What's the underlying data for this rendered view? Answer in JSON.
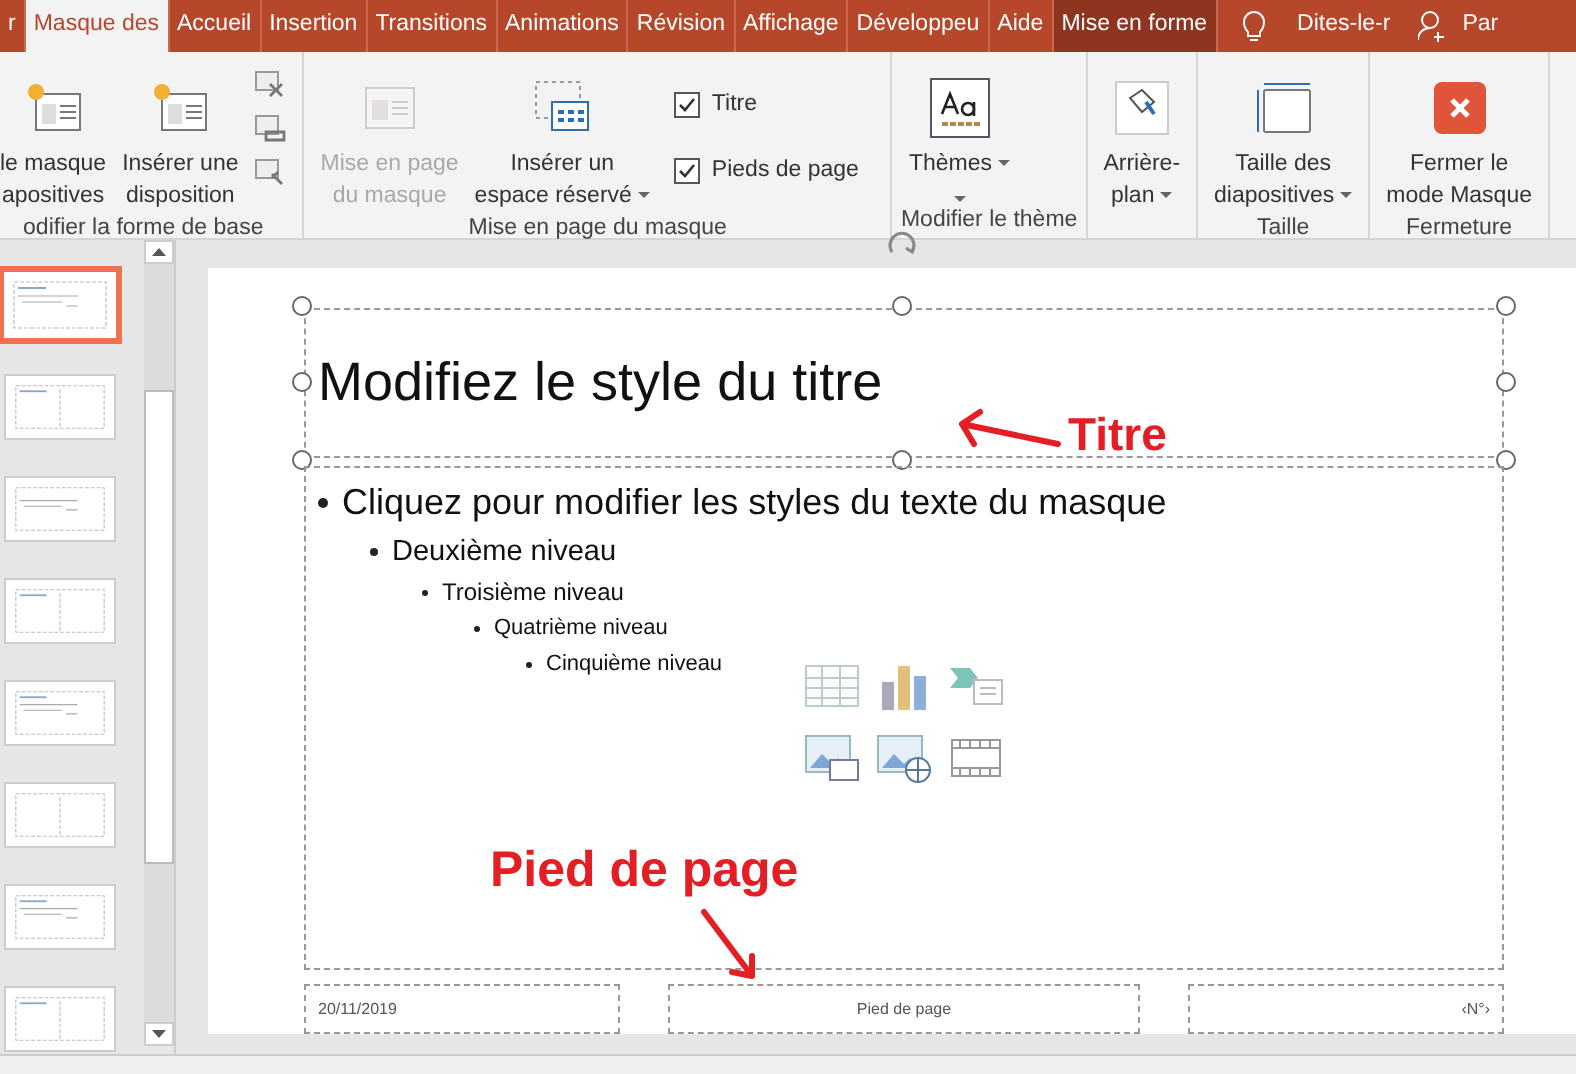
{
  "tabs": [
    {
      "label": "r",
      "selected": false,
      "kind": "tab"
    },
    {
      "label": "Masque des",
      "selected": true,
      "kind": "tab"
    },
    {
      "label": "Accueil",
      "selected": false,
      "kind": "tab"
    },
    {
      "label": "Insertion",
      "selected": false,
      "kind": "tab"
    },
    {
      "label": "Transitions",
      "selected": false,
      "kind": "tab"
    },
    {
      "label": "Animations",
      "selected": false,
      "kind": "tab"
    },
    {
      "label": "Révision",
      "selected": false,
      "kind": "tab"
    },
    {
      "label": "Affichage",
      "selected": false,
      "kind": "tab"
    },
    {
      "label": "Développeu",
      "selected": false,
      "kind": "tab"
    },
    {
      "label": "Aide",
      "selected": false,
      "kind": "tab"
    },
    {
      "label": "Mise en forme",
      "selected": false,
      "kind": "contextual"
    }
  ],
  "tell_me": "Dites-le-r",
  "account": "Par",
  "ribbon": {
    "groups": [
      {
        "label": "odifier la forme de base",
        "items": [
          {
            "kind": "large",
            "lines": [
              "le masque",
              "apositives"
            ],
            "disabled": false,
            "dropdown": false
          },
          {
            "kind": "large",
            "lines": [
              "Insérer une",
              "disposition"
            ],
            "disabled": false,
            "dropdown": false
          },
          {
            "kind": "smallicons"
          }
        ]
      },
      {
        "label": "Mise en page du masque",
        "items": [
          {
            "kind": "large",
            "lines": [
              "Mise en page",
              "du masque"
            ],
            "disabled": true,
            "dropdown": false
          },
          {
            "kind": "large",
            "lines": [
              "Insérer un",
              "espace réservé"
            ],
            "disabled": false,
            "dropdown": true
          },
          {
            "kind": "checkboxes",
            "options": [
              {
                "label": "Titre",
                "checked": true
              },
              {
                "label": "Pieds de page",
                "checked": true
              }
            ]
          }
        ]
      },
      {
        "label": "Modifier le thème",
        "items": [
          {
            "kind": "large",
            "lines": [
              "Thèmes"
            ],
            "disabled": false,
            "dropdown": true
          }
        ]
      },
      {
        "items": [
          {
            "kind": "large",
            "lines": [
              "Arrière-",
              "plan"
            ],
            "disabled": false,
            "dropdown": true
          }
        ]
      },
      {
        "label": "Taille",
        "items": [
          {
            "kind": "large",
            "lines": [
              "Taille des",
              "diapositives"
            ],
            "disabled": false,
            "dropdown": true
          }
        ]
      },
      {
        "label": "Fermeture",
        "items": [
          {
            "kind": "large",
            "lines": [
              "Fermer le",
              "mode Masque"
            ],
            "disabled": false,
            "dropdown": false
          }
        ]
      }
    ]
  },
  "thumbnails": [
    {
      "selected": true
    },
    {
      "selected": false
    },
    {
      "selected": false
    },
    {
      "selected": false
    },
    {
      "selected": false
    },
    {
      "selected": false
    },
    {
      "selected": false
    },
    {
      "selected": false
    }
  ],
  "slide": {
    "title": "Modifiez le style du titre",
    "body": [
      {
        "text": "Cliquez pour modifier les styles du texte du masque",
        "children": [
          {
            "text": "Deuxième niveau",
            "children": [
              {
                "text": "Troisième niveau",
                "children": [
                  {
                    "text": "Quatrième niveau",
                    "children": [
                      {
                        "text": "Cinquième niveau"
                      }
                    ]
                  }
                ]
              }
            ]
          }
        ]
      }
    ],
    "footer": {
      "date": "20/11/2019",
      "text": "Pied de page",
      "number": "‹N°›"
    }
  },
  "annotations": [
    {
      "text": "Titre"
    },
    {
      "text": "Pied de page"
    }
  ]
}
